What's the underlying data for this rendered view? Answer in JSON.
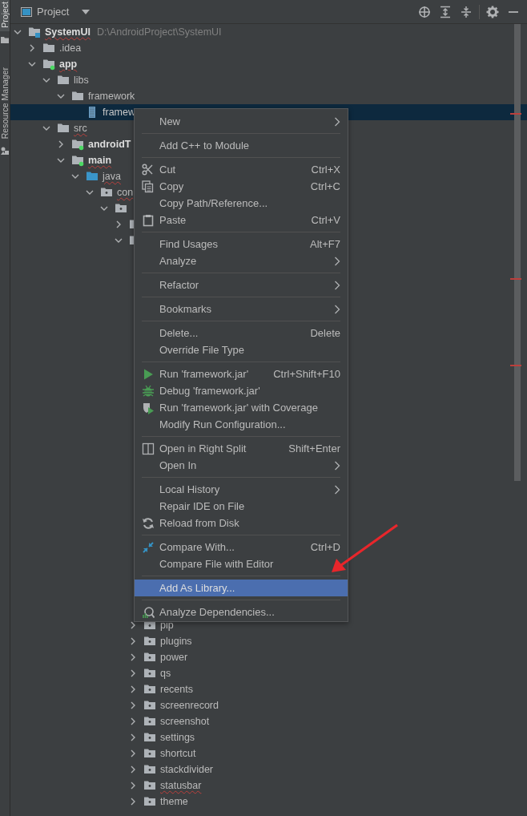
{
  "tool_strip": [
    {
      "label": "Project",
      "selected": true,
      "kind": "folder"
    },
    {
      "label": "Resource Manager",
      "selected": false,
      "kind": "resource"
    }
  ],
  "panel": {
    "title": "Project",
    "toolbar": [
      {
        "kind": "locate"
      },
      {
        "kind": "expand-all"
      },
      {
        "kind": "collapse-all"
      },
      {
        "kind": "settings"
      },
      {
        "kind": "minimize"
      }
    ]
  },
  "tree": [
    {
      "label": "SystemUI",
      "path": "D:\\AndroidProject\\SystemUI",
      "kind": "module",
      "bold": true,
      "typo": true,
      "expanded": true,
      "selected": false,
      "children": [
        {
          "label": ".idea",
          "kind": "folder",
          "expanded": false,
          "selected": false
        },
        {
          "label": "app",
          "kind": "module-folder",
          "bold": true,
          "typo": true,
          "expanded": true,
          "selected": false,
          "children": [
            {
              "label": "libs",
              "kind": "folder",
              "expanded": true,
              "selected": false,
              "children": [
                {
                  "label": "framework",
                  "kind": "folder",
                  "expanded": true,
                  "selected": false,
                  "children": [
                    {
                      "label": "framew",
                      "kind": "jar",
                      "selected": true
                    }
                  ]
                }
              ]
            },
            {
              "label": "src",
              "kind": "folder",
              "typo": true,
              "expanded": true,
              "selected": false,
              "children": [
                {
                  "label": "androidT",
                  "kind": "module-folder",
                  "bold": true,
                  "expanded": false,
                  "selected": false
                },
                {
                  "label": "main",
                  "kind": "module-folder",
                  "bold": true,
                  "typo": true,
                  "expanded": true,
                  "selected": false,
                  "children": [
                    {
                      "label": "java",
                      "kind": "source-root",
                      "typo": true,
                      "expanded": true,
                      "selected": false,
                      "children": [
                        {
                          "label": "con",
                          "kind": "package",
                          "typo": true,
                          "expanded": true,
                          "selected": false,
                          "children": [
                            {
                              "kind": "package",
                              "expanded": true,
                              "selected": false,
                              "children": [
                                {
                                  "kind": "package",
                                  "expanded": false,
                                  "selected": false
                                },
                                {
                                  "kind": "package",
                                  "expanded": true,
                                  "selected": false,
                                  "children": [
                                    {
                                      "label": "pip",
                                      "kind": "package",
                                      "expanded": false,
                                      "selected": false
                                    },
                                    {
                                      "label": "plugins",
                                      "kind": "package",
                                      "expanded": false,
                                      "selected": false
                                    },
                                    {
                                      "label": "power",
                                      "kind": "package",
                                      "expanded": false,
                                      "selected": false
                                    },
                                    {
                                      "label": "qs",
                                      "kind": "package",
                                      "expanded": false,
                                      "selected": false
                                    },
                                    {
                                      "label": "recents",
                                      "kind": "package",
                                      "expanded": false,
                                      "selected": false
                                    },
                                    {
                                      "label": "screenrecord",
                                      "kind": "package",
                                      "expanded": false,
                                      "selected": false
                                    },
                                    {
                                      "label": "screenshot",
                                      "kind": "package",
                                      "expanded": false,
                                      "selected": false
                                    },
                                    {
                                      "label": "settings",
                                      "kind": "package",
                                      "expanded": false,
                                      "selected": false
                                    },
                                    {
                                      "label": "shortcut",
                                      "kind": "package",
                                      "expanded": false,
                                      "selected": false
                                    },
                                    {
                                      "label": "stackdivider",
                                      "kind": "package",
                                      "expanded": false,
                                      "selected": false
                                    },
                                    {
                                      "label": "statusbar",
                                      "kind": "package",
                                      "typo": true,
                                      "expanded": false,
                                      "selected": false
                                    },
                                    {
                                      "label": "theme",
                                      "kind": "package",
                                      "expanded": false,
                                      "selected": false
                                    }
                                  ]
                                }
                              ]
                            }
                          ]
                        }
                      ]
                    }
                  ]
                }
              ]
            }
          ]
        }
      ]
    }
  ],
  "context_menu": {
    "groups": [
      [
        {
          "label": "New",
          "submenu": true,
          "selected": false
        }
      ],
      [
        {
          "label": "Add C++ to Module",
          "selected": false
        }
      ],
      [
        {
          "label": "Cut",
          "shortcut": "Ctrl+X",
          "kind": "cut",
          "selected": false
        },
        {
          "label": "Copy",
          "shortcut": "Ctrl+C",
          "kind": "copy",
          "selected": false
        },
        {
          "label": "Copy Path/Reference...",
          "selected": false
        },
        {
          "label": "Paste",
          "shortcut": "Ctrl+V",
          "kind": "paste",
          "selected": false
        }
      ],
      [
        {
          "label": "Find Usages",
          "shortcut": "Alt+F7",
          "selected": false
        },
        {
          "label": "Analyze",
          "submenu": true,
          "selected": false
        }
      ],
      [
        {
          "label": "Refactor",
          "submenu": true,
          "selected": false
        }
      ],
      [
        {
          "label": "Bookmarks",
          "submenu": true,
          "selected": false
        }
      ],
      [
        {
          "label": "Delete...",
          "shortcut": "Delete",
          "selected": false
        },
        {
          "label": "Override File Type",
          "selected": false
        }
      ],
      [
        {
          "label": "Run 'framework.jar'",
          "shortcut": "Ctrl+Shift+F10",
          "kind": "run",
          "selected": false
        },
        {
          "label": "Debug 'framework.jar'",
          "kind": "debug",
          "selected": false
        },
        {
          "label": "Run 'framework.jar' with Coverage",
          "kind": "coverage",
          "selected": false
        },
        {
          "label": "Modify Run Configuration...",
          "selected": false
        }
      ],
      [
        {
          "label": "Open in Right Split",
          "shortcut": "Shift+Enter",
          "kind": "split",
          "selected": false
        },
        {
          "label": "Open In",
          "submenu": true,
          "selected": false
        }
      ],
      [
        {
          "label": "Local History",
          "submenu": true,
          "selected": false
        },
        {
          "label": "Repair IDE on File",
          "selected": false
        },
        {
          "label": "Reload from Disk",
          "kind": "reload",
          "selected": false
        }
      ],
      [
        {
          "label": "Compare With...",
          "shortcut": "Ctrl+D",
          "kind": "compare",
          "selected": false
        },
        {
          "label": "Compare File with Editor",
          "selected": false
        }
      ],
      [
        {
          "label": "Add As Library...",
          "selected": true
        }
      ],
      [
        {
          "label": "Analyze Dependencies...",
          "kind": "analyze",
          "selected": false
        }
      ]
    ]
  },
  "annotation": {
    "kind": "arrow"
  }
}
